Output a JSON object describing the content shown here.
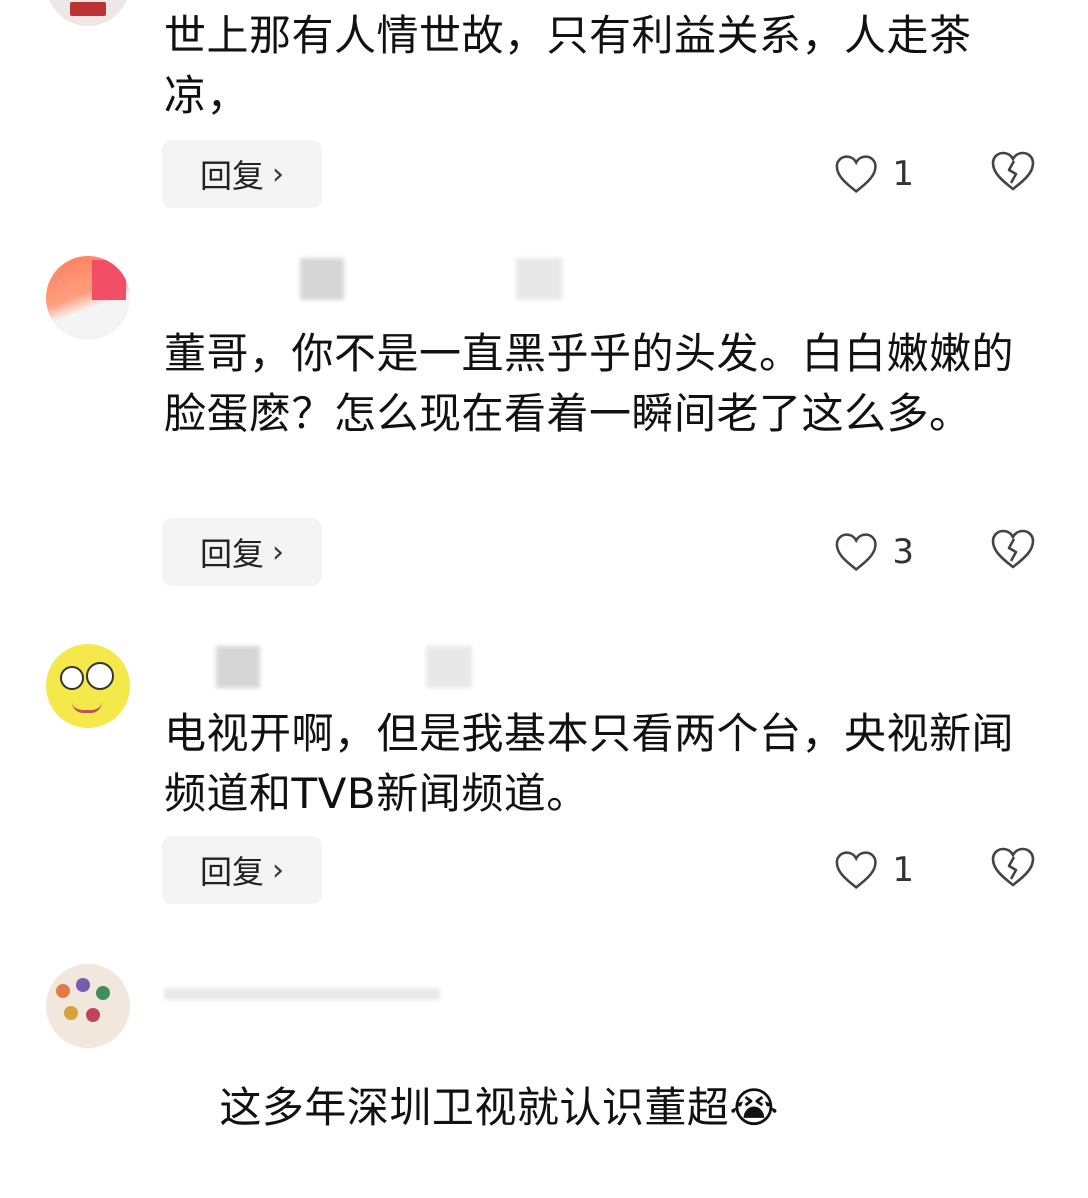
{
  "comments": [
    {
      "text": "世上那有人情世故，只有利益关系，人走茶凉，",
      "reply_label": "回复",
      "like_count": "1"
    },
    {
      "text": "董哥，你不是一直黑乎乎的头发。白白嫩嫩的脸蛋麽？怎么现在看着一瞬间老了这么多。",
      "reply_label": "回复",
      "like_count": "3"
    },
    {
      "text": "电视开啊，但是我基本只看两个台，央视新闻频道和TVB新闻频道。",
      "reply_label": "回复",
      "like_count": "1"
    },
    {
      "text": "这多年深圳卫视就认识董超",
      "emoji": "😭"
    }
  ],
  "icons": {
    "like": "heart-outline-icon",
    "dislike": "broken-heart-icon",
    "chevron": "chevron-right-icon"
  }
}
